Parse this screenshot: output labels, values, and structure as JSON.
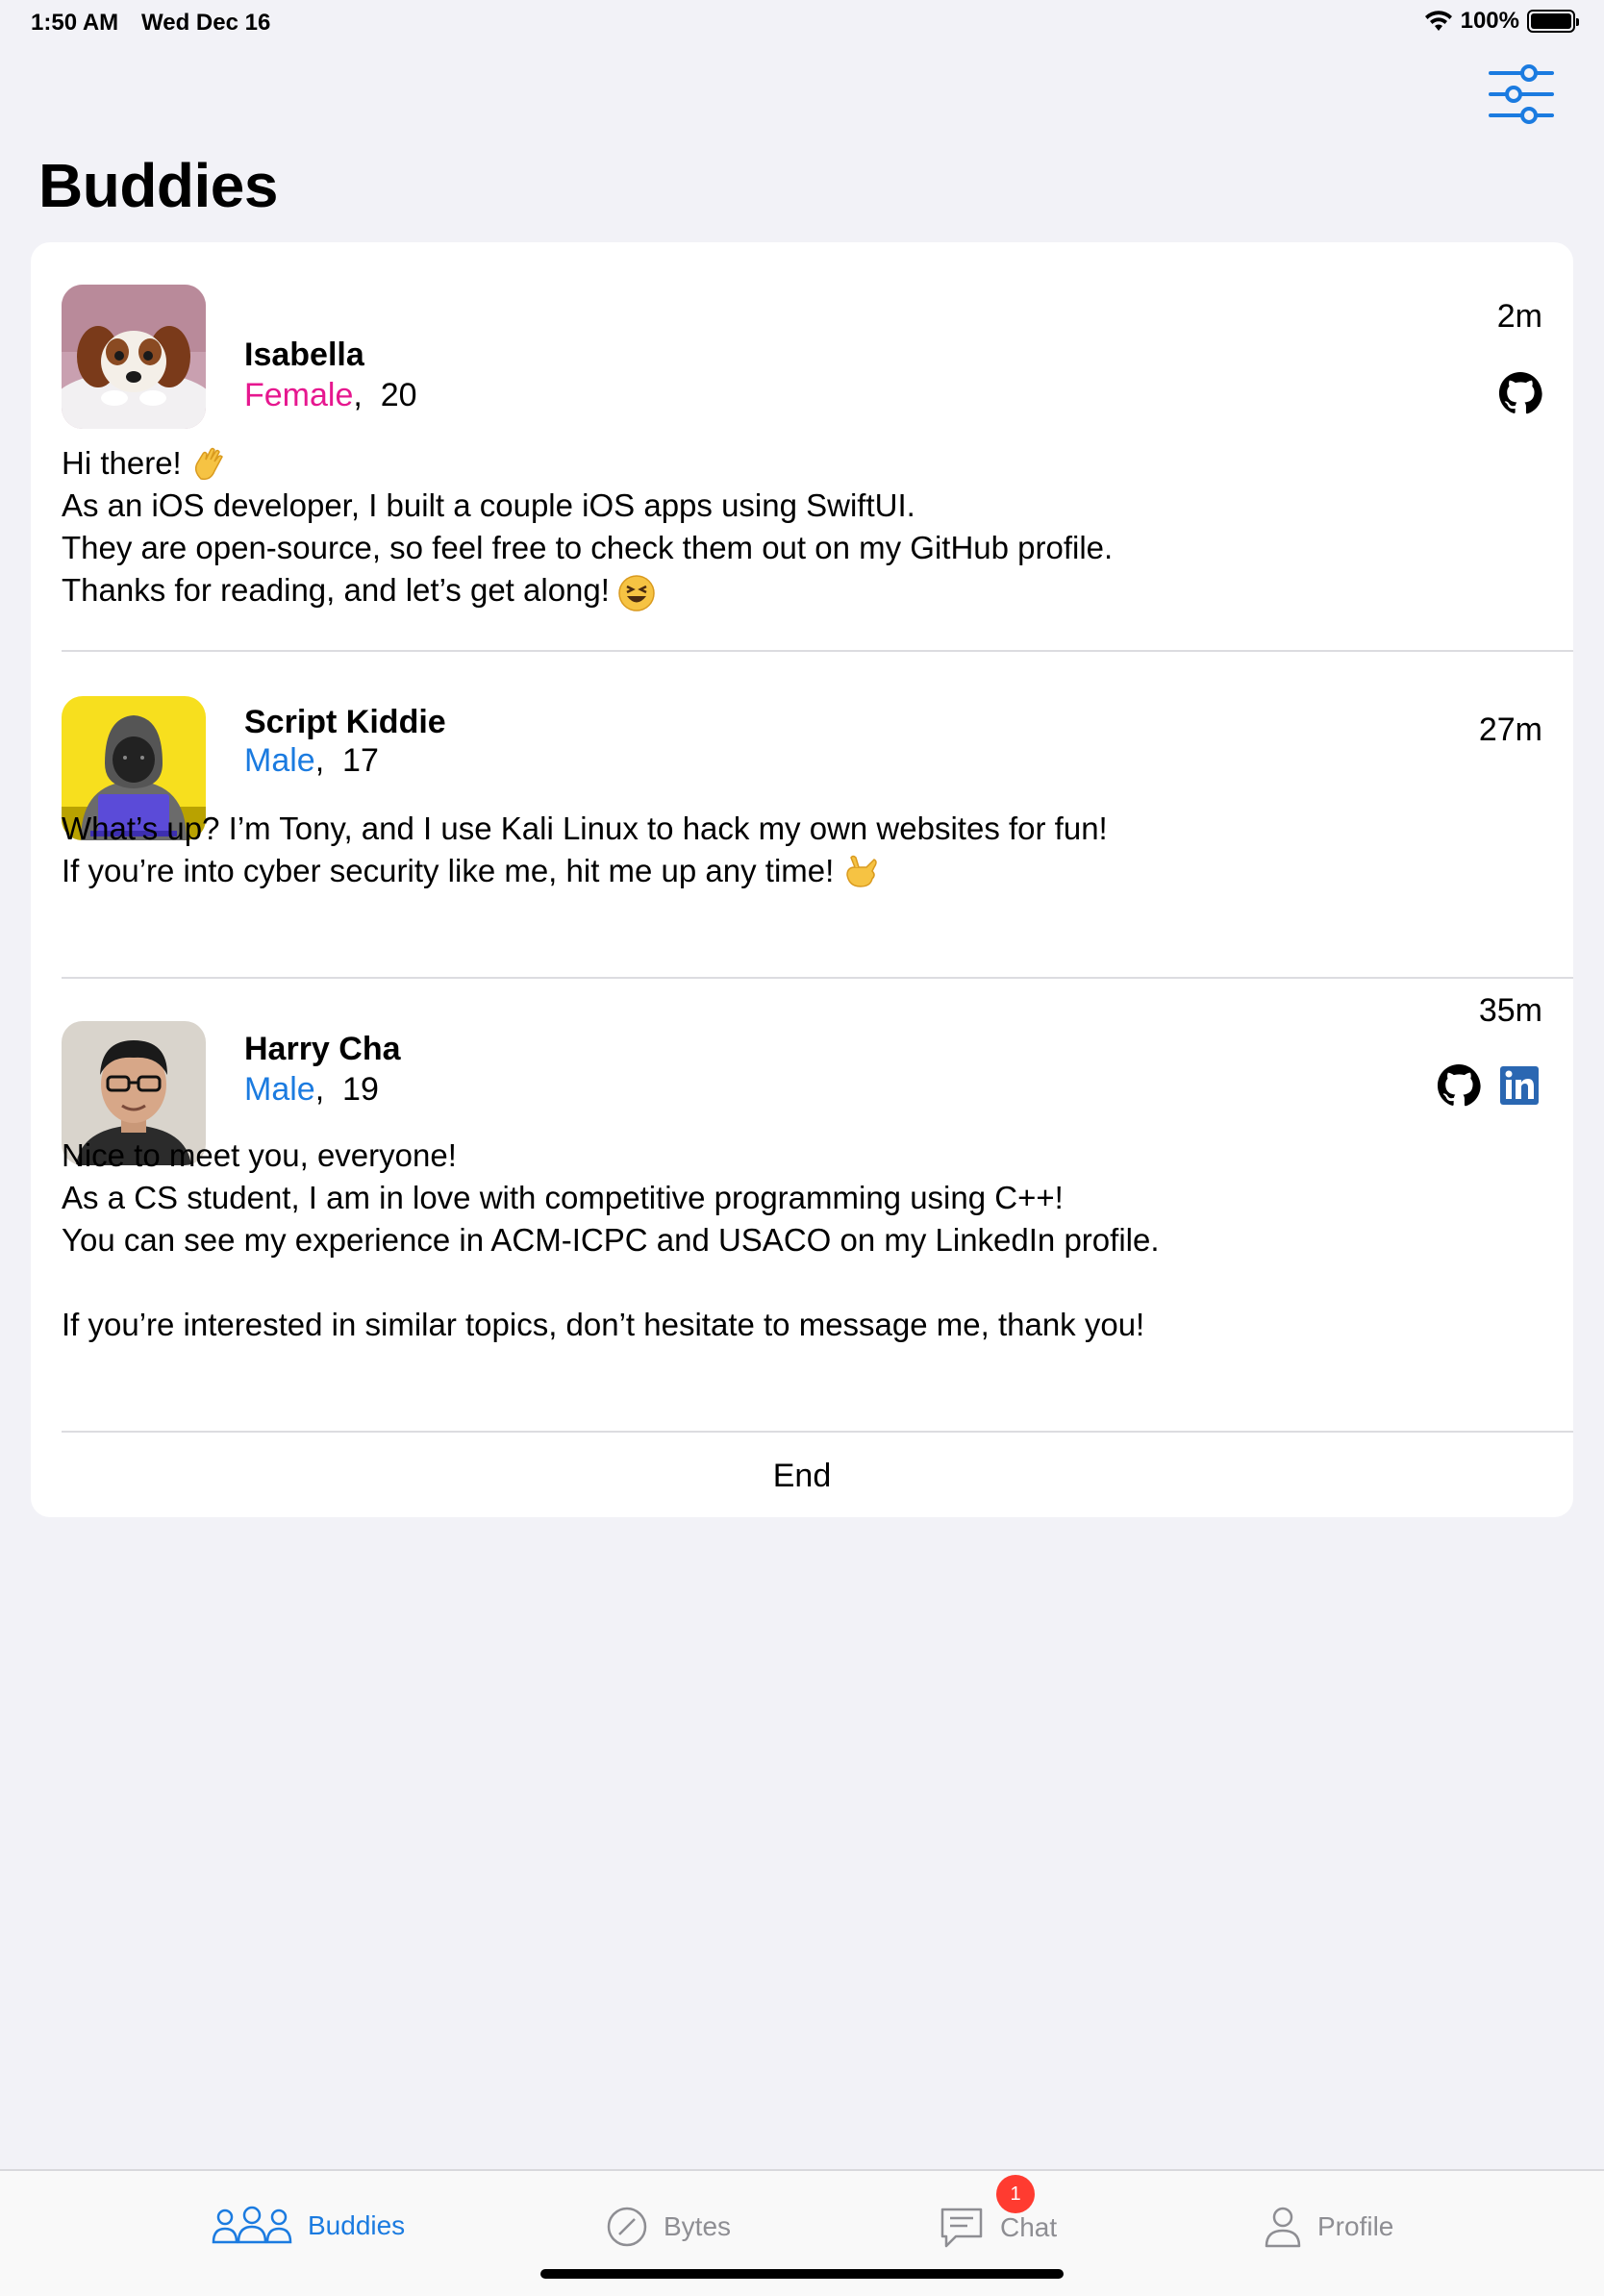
{
  "status": {
    "time": "1:50 AM",
    "date": "Wed Dec 16",
    "battery": "100%"
  },
  "nav": {
    "title": "Buddies",
    "filter_icon": "sliders-icon"
  },
  "posts": [
    {
      "name": "Isabella",
      "gender": "Female",
      "age": "20",
      "time": "2m",
      "avatar": "puppy-photo",
      "socials": [
        "github"
      ],
      "bio": [
        "Hi there!",
        "As an iOS developer, I built a couple iOS apps using SwiftUI.",
        "They are open-source, so feel free to check them out on my GitHub profile.",
        "Thanks for reading, and let’s get along!"
      ]
    },
    {
      "name": "Script Kiddie",
      "gender": "Male",
      "age": "17",
      "time": "27m",
      "avatar": "hacker-illustration",
      "socials": [],
      "bio": [
        "What’s up? I’m Tony, and I use Kali Linux to hack my own websites for fun!",
        "If you’re into cyber security like me, hit me up any time!"
      ]
    },
    {
      "name": "Harry Cha",
      "gender": "Male",
      "age": "19",
      "time": "35m",
      "avatar": "portrait-photo",
      "socials": [
        "github",
        "linkedin"
      ],
      "bio": [
        "Nice to meet you, everyone!",
        "As a CS student, I am in love with competitive programming using C++!",
        "You can see my experience in ACM-ICPC and USACO on my LinkedIn profile.",
        "",
        "If you’re interested in similar topics, don’t hesitate to message me, thank you!"
      ]
    }
  ],
  "end_label": "End",
  "tabs": [
    {
      "label": "Buddies",
      "icon": "people-icon",
      "active": true
    },
    {
      "label": "Bytes",
      "icon": "compass-icon",
      "active": false
    },
    {
      "label": "Chat",
      "icon": "chat-bubble-icon",
      "active": false,
      "badge": "1"
    },
    {
      "label": "Profile",
      "icon": "person-icon",
      "active": false
    }
  ],
  "colors": {
    "accent": "#1b7be0",
    "female": "#e6178f",
    "badge": "#ff3b30",
    "background": "#f2f2f7"
  }
}
